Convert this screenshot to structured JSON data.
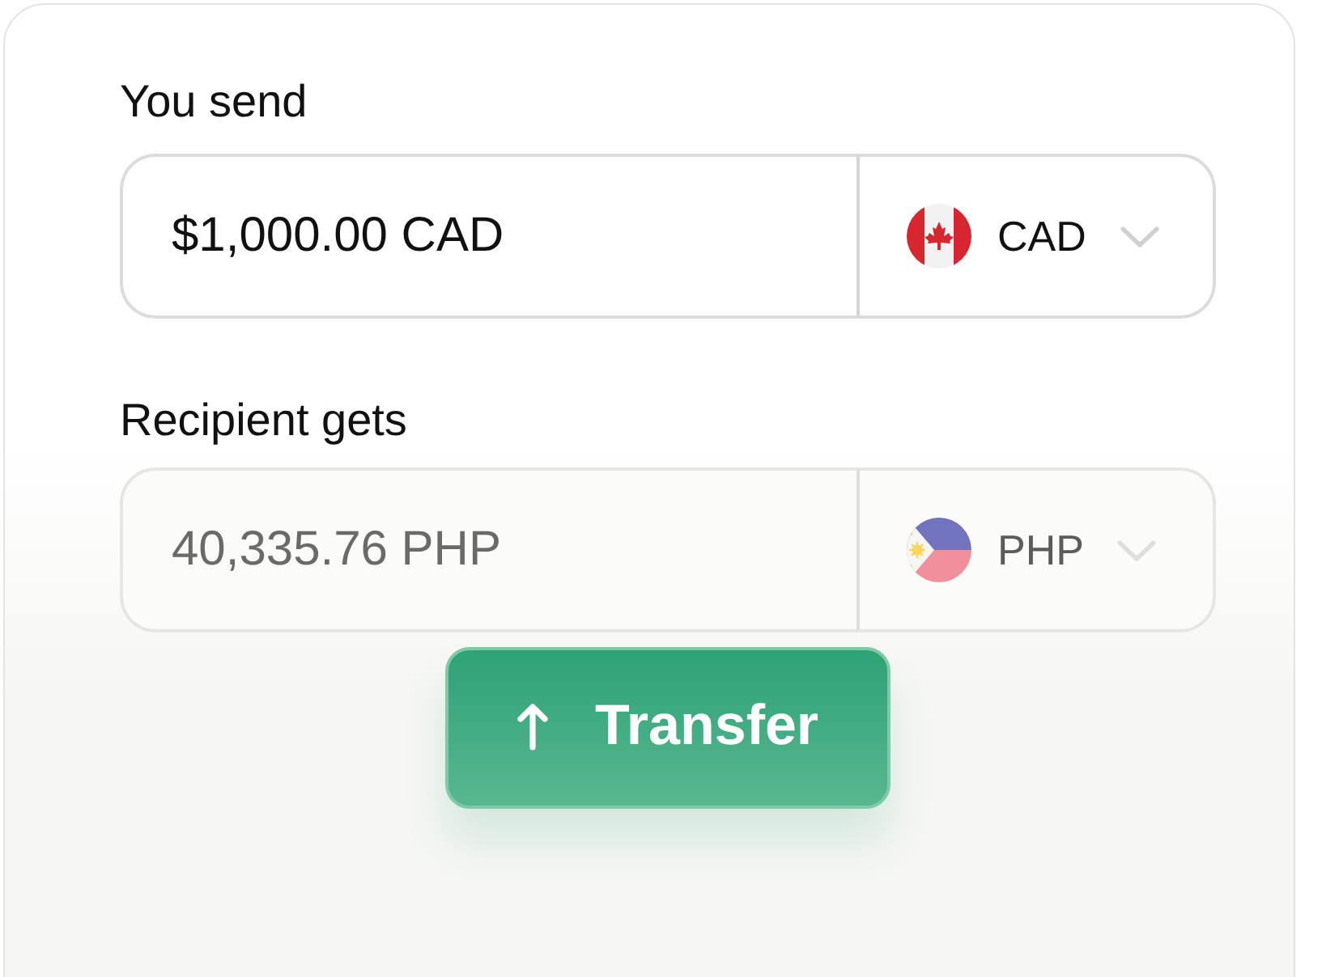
{
  "fields": [
    {
      "label": "You send",
      "value": "$1,000.00 CAD",
      "currency": "CAD",
      "disabled": false
    },
    {
      "label": "Recipient gets",
      "value": "40,335.76 PHP",
      "currency": "PHP",
      "disabled": true
    }
  ],
  "button": {
    "label": "Transfer"
  }
}
